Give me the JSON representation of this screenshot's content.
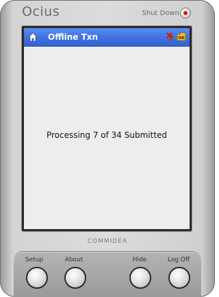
{
  "brand": "Ocius",
  "shutdown_label": "Shut Down",
  "window_title": "Offline Txn",
  "status_message": "Processing 7 of 34 Submitted",
  "footer_brand": "COMMIDEA",
  "buttons": {
    "setup": "Setup",
    "about": "About",
    "hide": "Hide",
    "logoff": "Log Off"
  },
  "icons": {
    "home": "home-icon",
    "disconnect": "disconnect-icon",
    "ok": "ok-icon",
    "power": "power-icon"
  },
  "colors": {
    "titlebar": "#3d6fe0",
    "power_dot": "#d01818",
    "screen_bg": "#ededed"
  }
}
